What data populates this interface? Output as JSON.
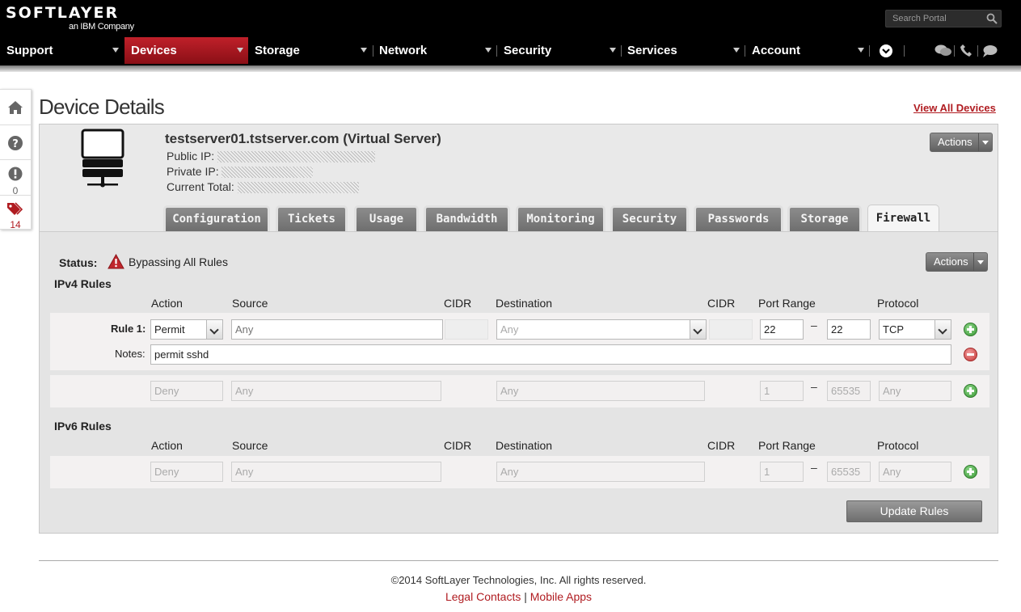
{
  "brand": {
    "logo": "SOFTLAYER",
    "tagline": "an IBM Company"
  },
  "search": {
    "placeholder": "Search Portal",
    "icon": "search-icon"
  },
  "nav": {
    "items": [
      {
        "label": "Support"
      },
      {
        "label": "Devices",
        "active": true
      },
      {
        "label": "Storage"
      },
      {
        "label": "Network"
      },
      {
        "label": "Security"
      },
      {
        "label": "Services"
      },
      {
        "label": "Account"
      }
    ],
    "icons": [
      "chevron-circle-icon",
      "chat-icon",
      "phone-icon",
      "comment-icon"
    ]
  },
  "rail": {
    "items": [
      {
        "icon": "home-icon"
      },
      {
        "icon": "help-icon"
      },
      {
        "icon": "alert-icon",
        "count": "0"
      },
      {
        "icon": "tags-icon",
        "count": "14"
      }
    ]
  },
  "page": {
    "title": "Device Details",
    "view_all": "View All Devices"
  },
  "device": {
    "name": "testserver01.tstserver.com (Virtual Server)",
    "public_ip_label": "Public IP:",
    "private_ip_label": "Private IP:",
    "current_total_label": "Current Total:",
    "actions_label": "Actions"
  },
  "tabs": [
    "Configuration",
    "Tickets",
    "Usage",
    "Bandwidth",
    "Monitoring",
    "Security",
    "Passwords",
    "Storage",
    "Firewall"
  ],
  "active_tab": "Firewall",
  "firewall": {
    "status_label": "Status:",
    "status_value": "Bypassing All Rules",
    "actions_label": "Actions",
    "columns": [
      "Action",
      "Source",
      "CIDR",
      "Destination",
      "CIDR",
      "Port Range",
      "Protocol"
    ],
    "ipv4": {
      "heading": "IPv4 Rules",
      "rule1": {
        "label": "Rule 1:",
        "action": "Permit",
        "source_placeholder": "Any",
        "destination_placeholder": "Any",
        "port_from": "22",
        "port_to": "22",
        "protocol": "TCP",
        "notes_label": "Notes:",
        "notes": "permit sshd"
      },
      "default": {
        "action": "Deny",
        "source": "Any",
        "destination": "Any",
        "port_from": "1",
        "port_to": "65535",
        "protocol": "Any"
      }
    },
    "ipv6": {
      "heading": "IPv6 Rules",
      "default": {
        "action": "Deny",
        "source": "Any",
        "destination": "Any",
        "port_from": "1",
        "port_to": "65535",
        "protocol": "Any"
      }
    },
    "port_separator": "–",
    "update_label": "Update Rules"
  },
  "footer": {
    "copyright": "©2014 SoftLayer Technologies, Inc. All rights reserved.",
    "legal": "Legal Contacts",
    "sep": "|",
    "mobile": "Mobile Apps"
  },
  "colors": {
    "brand_red": "#b01c21",
    "topbar": "#000000",
    "active_nav": "#a8151c",
    "add": "#3c9a36",
    "remove": "#c73a3a"
  }
}
